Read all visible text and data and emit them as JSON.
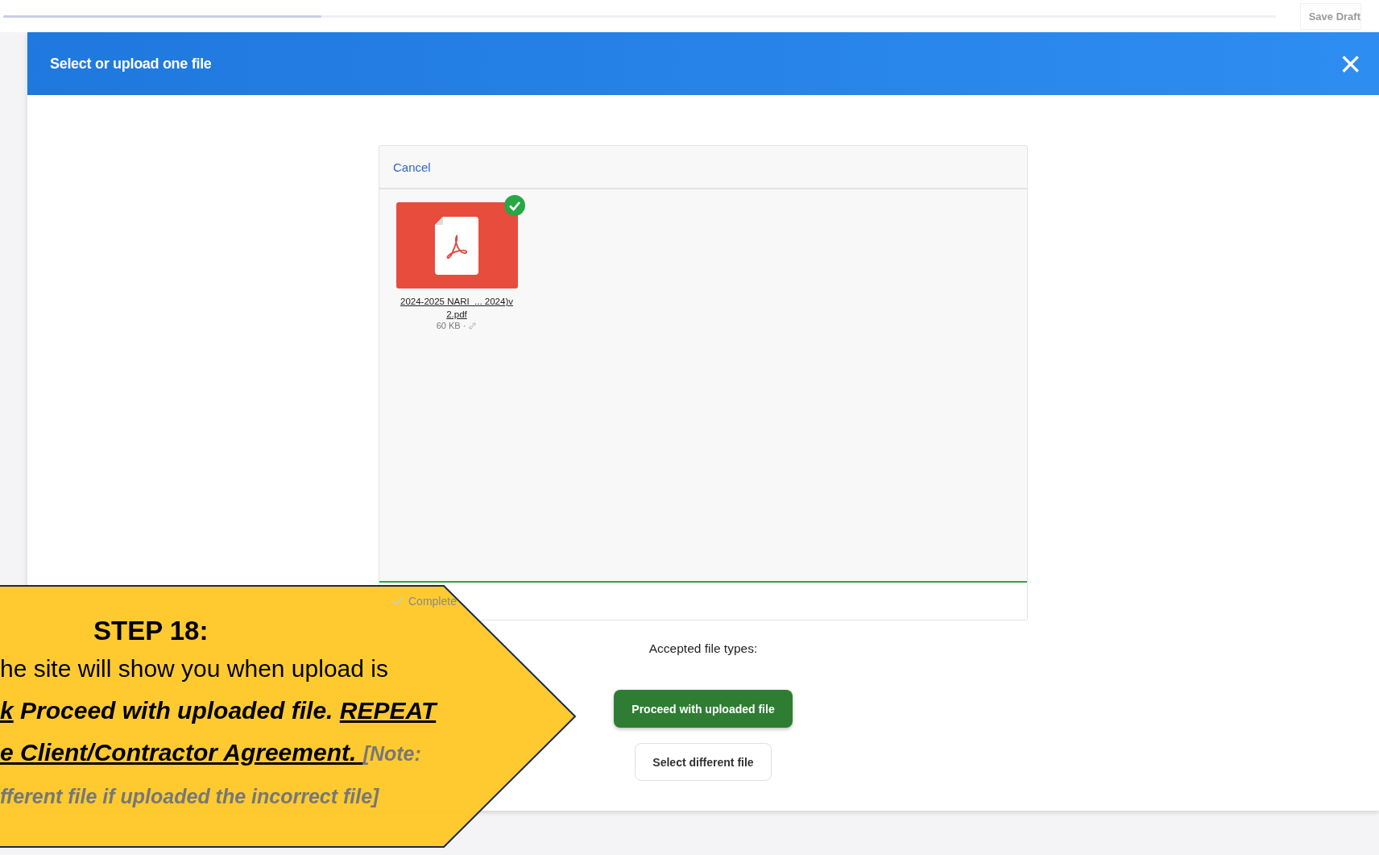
{
  "page": {
    "progress": {
      "level": 0.25
    },
    "save_draft": {
      "label": "Save Draft",
      "disabled": true
    }
  },
  "dialog": {
    "title": "Select or upload one file",
    "close": "×",
    "panel": {
      "cancel": "Cancel",
      "files": [
        {
          "name": "2024-2025 NARI_... 2024)v 2.pdf",
          "size": "60 KB ·",
          "uploaded": true
        }
      ],
      "upload": {
        "level": 1.0,
        "status": "Complete"
      }
    },
    "accepted_types": "Accepted file types:",
    "buttons": [
      {
        "label": "Proceed with uploaded file",
        "kind": "primary"
      },
      {
        "label": "Select different file",
        "kind": "secondary"
      }
    ]
  },
  "callout": {
    "heading": "STEP 18:",
    "lines": [
      [
        {
          "text": "he site will show you when upload is",
          "kind": "plain"
        }
      ],
      [
        {
          "text": "k",
          "kind": "underlined"
        },
        {
          "text": " Proceed with uploaded file. ",
          "kind": "emphasis"
        },
        {
          "text": "REPEAT",
          "kind": "underlined"
        }
      ],
      [
        {
          "text": "e Client/Contractor Agreement. ",
          "kind": "underlined"
        },
        {
          "text": "[Note:",
          "kind": "note"
        }
      ],
      [
        {
          "text": "fferent file if uploaded the incorrect file]",
          "kind": "note"
        }
      ]
    ]
  }
}
